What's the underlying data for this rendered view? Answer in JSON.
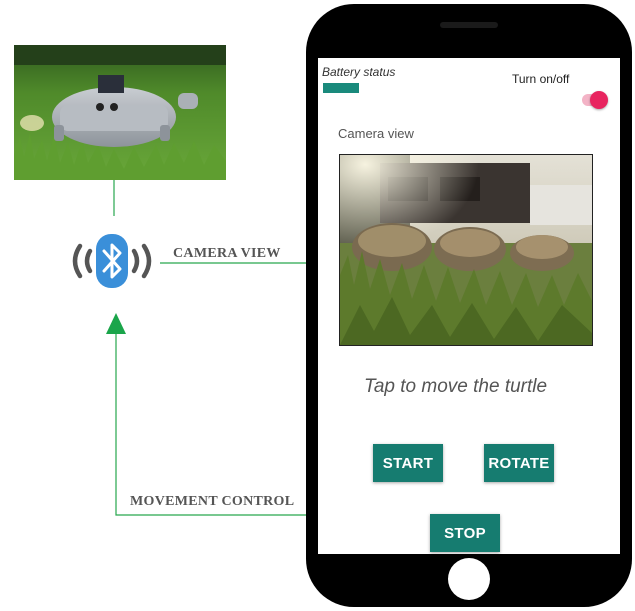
{
  "phone": {
    "battery_label": "Battery status",
    "toggle_label": "Turn on/off",
    "camera_label": "Camera view",
    "hint": "Tap to move the turtle",
    "buttons": {
      "start": "START",
      "rotate": "ROTATE",
      "stop": "STOP"
    }
  },
  "connections": {
    "camera_view": "CAMERA VIEW",
    "movement_control": "MOVEMENT CONTROL"
  },
  "colors": {
    "accent": "#167c70",
    "bluetooth": "#3a8fd9",
    "arrow": "#1aa54a",
    "toggle": "#e8245f"
  },
  "icons": {
    "bluetooth": "bluetooth-icon",
    "home": "home-button"
  }
}
